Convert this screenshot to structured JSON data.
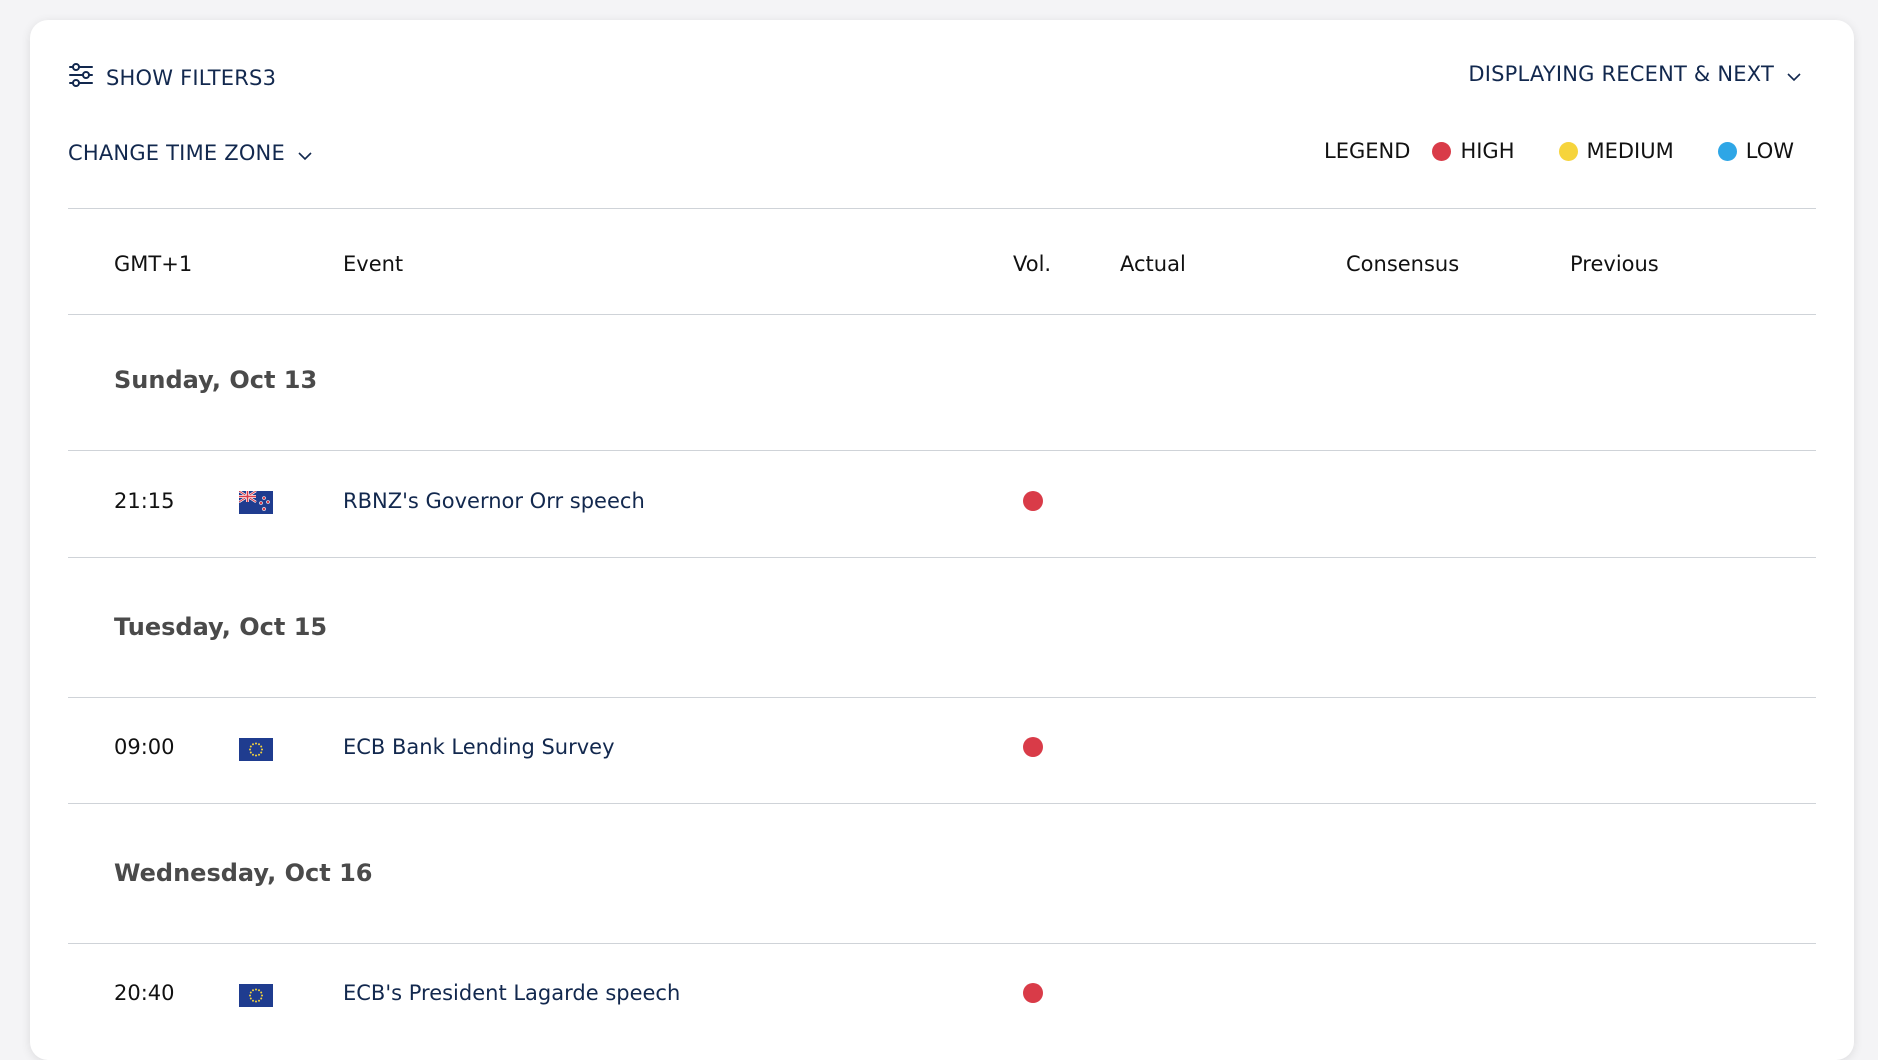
{
  "toolbar": {
    "show_filters_label": "SHOW FILTERS",
    "filters_count": "3",
    "display_mode_label": "DISPLAYING RECENT & NEXT",
    "time_zone_label": "CHANGE TIME ZONE"
  },
  "legend": {
    "title": "LEGEND",
    "items": [
      {
        "label": "HIGH",
        "color": "#d93b48"
      },
      {
        "label": "MEDIUM",
        "color": "#f6d43c"
      },
      {
        "label": "LOW",
        "color": "#2ea6e6"
      }
    ]
  },
  "table": {
    "columns": {
      "time": "GMT+1",
      "event": "Event",
      "volatility": "Vol.",
      "actual": "Actual",
      "consensus": "Consensus",
      "previous": "Previous"
    },
    "days": [
      {
        "date": "Sunday, Oct 13",
        "events": [
          {
            "time": "21:15",
            "flag": "new-zealand-flag-icon",
            "name": "RBNZ's Governor Orr speech",
            "volatility": "HIGH",
            "actual": "",
            "consensus": "",
            "previous": ""
          }
        ]
      },
      {
        "date": "Tuesday, Oct 15",
        "events": [
          {
            "time": "09:00",
            "flag": "european-union-flag-icon",
            "name": "ECB Bank Lending Survey",
            "volatility": "HIGH",
            "actual": "",
            "consensus": "",
            "previous": ""
          }
        ]
      },
      {
        "date": "Wednesday, Oct 16",
        "events": [
          {
            "time": "20:40",
            "flag": "european-union-flag-icon",
            "name": "ECB's President Lagarde speech",
            "volatility": "HIGH",
            "actual": "",
            "consensus": "",
            "previous": ""
          }
        ]
      }
    ]
  },
  "colors": {
    "accent": "#12284e",
    "high": "#d93b48",
    "divider": "#cfd3d8"
  }
}
